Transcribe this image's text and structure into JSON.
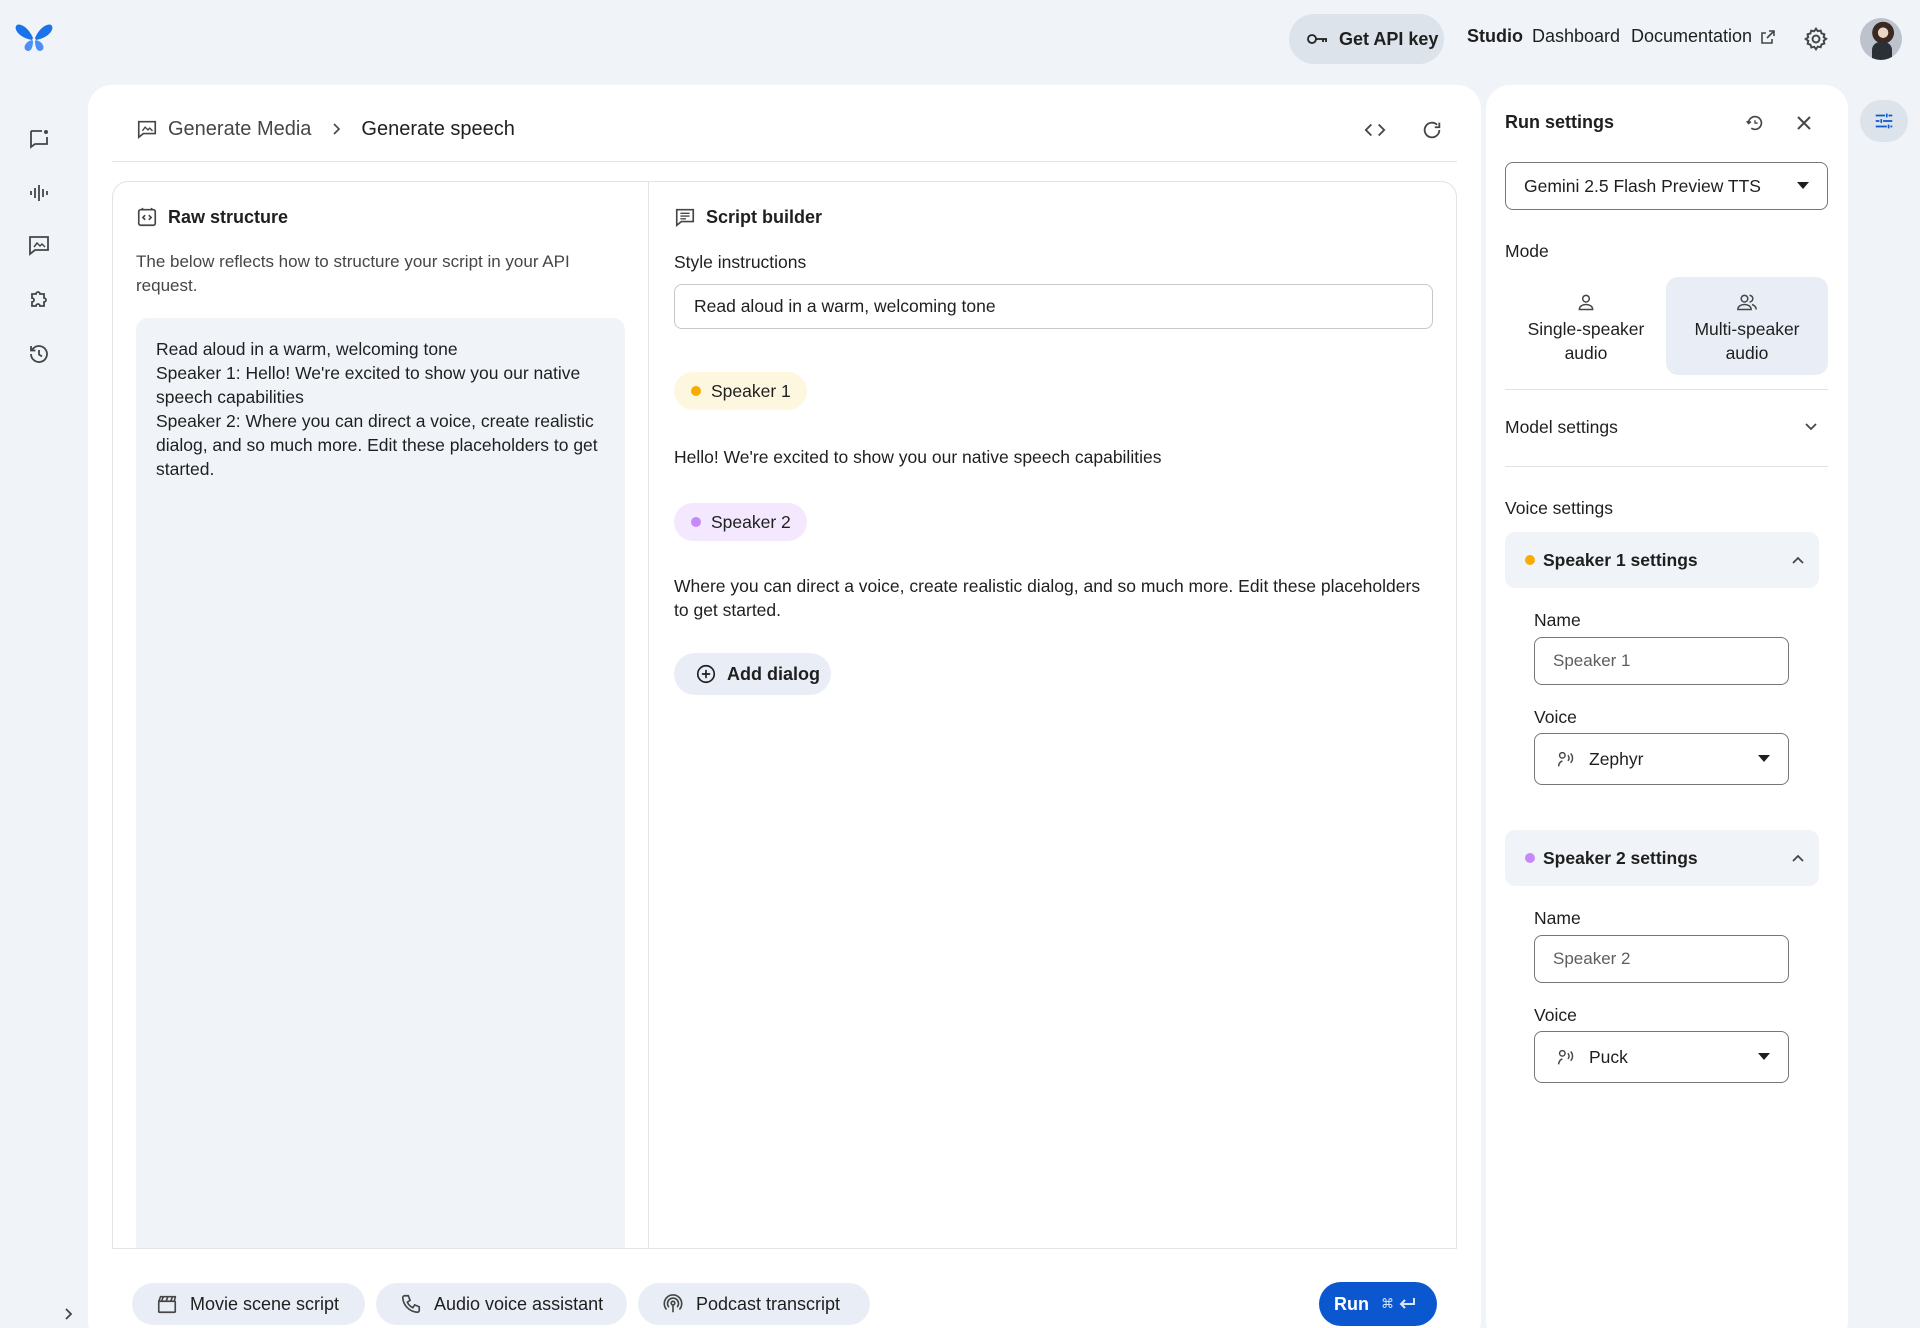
{
  "topbar": {
    "api_key_label": "Get API key",
    "nav": {
      "studio": "Studio",
      "dashboard": "Dashboard",
      "documentation": "Documentation"
    }
  },
  "breadcrumb": {
    "parent": "Generate Media",
    "current": "Generate speech"
  },
  "raw_structure": {
    "title": "Raw structure",
    "description": "The below reflects how to structure your script in your API request.",
    "lines": [
      "Read aloud in a warm, welcoming tone",
      "Speaker 1: Hello! We're excited to show you our native speech capabilities",
      "Speaker 2: Where you can direct a voice, create realistic dialog, and so much more. Edit these placeholders to get started."
    ]
  },
  "script_builder": {
    "title": "Script builder",
    "style_label": "Style instructions",
    "style_value": "Read aloud in a warm, welcoming tone",
    "dialogs": [
      {
        "speaker": "Speaker 1",
        "text": "Hello! We're excited to show you our native speech capabilities"
      },
      {
        "speaker": "Speaker 2",
        "text": "Where you can direct a voice, create realistic dialog, and so much more. Edit these placeholders to get started."
      }
    ],
    "add_dialog_label": "Add dialog"
  },
  "presets": [
    "Movie scene script",
    "Audio voice assistant",
    "Podcast transcript"
  ],
  "run": {
    "label": "Run",
    "shortcut": "⌘"
  },
  "run_settings": {
    "title": "Run settings",
    "model": "Gemini 2.5 Flash Preview TTS",
    "mode_label": "Mode",
    "modes": [
      {
        "label": "Single-speaker audio",
        "selected": false
      },
      {
        "label": "Multi-speaker audio",
        "selected": true
      }
    ],
    "model_settings_label": "Model settings",
    "voice_settings_label": "Voice settings",
    "speakers": [
      {
        "header": "Speaker 1 settings",
        "name_label": "Name",
        "name_placeholder": "Speaker 1",
        "voice_label": "Voice",
        "voice": "Zephyr"
      },
      {
        "header": "Speaker 2 settings",
        "name_label": "Name",
        "name_placeholder": "Speaker 2",
        "voice_label": "Voice",
        "voice": "Puck"
      }
    ]
  },
  "colors": {
    "speaker1_dot": "#f9ab00",
    "speaker1_chip": "#fef7e0",
    "speaker2_dot": "#c58af9",
    "speaker2_chip": "#f3e8fd",
    "accent": "#0b57d0",
    "page_bg": "#f0f4f9"
  },
  "icons": {
    "rail": [
      "chat-icon",
      "stream-audio-icon",
      "image-chat-icon",
      "extension-icon",
      "history-icon"
    ],
    "presets": [
      "clapperboard-icon",
      "phone-icon",
      "podcast-icon"
    ]
  }
}
